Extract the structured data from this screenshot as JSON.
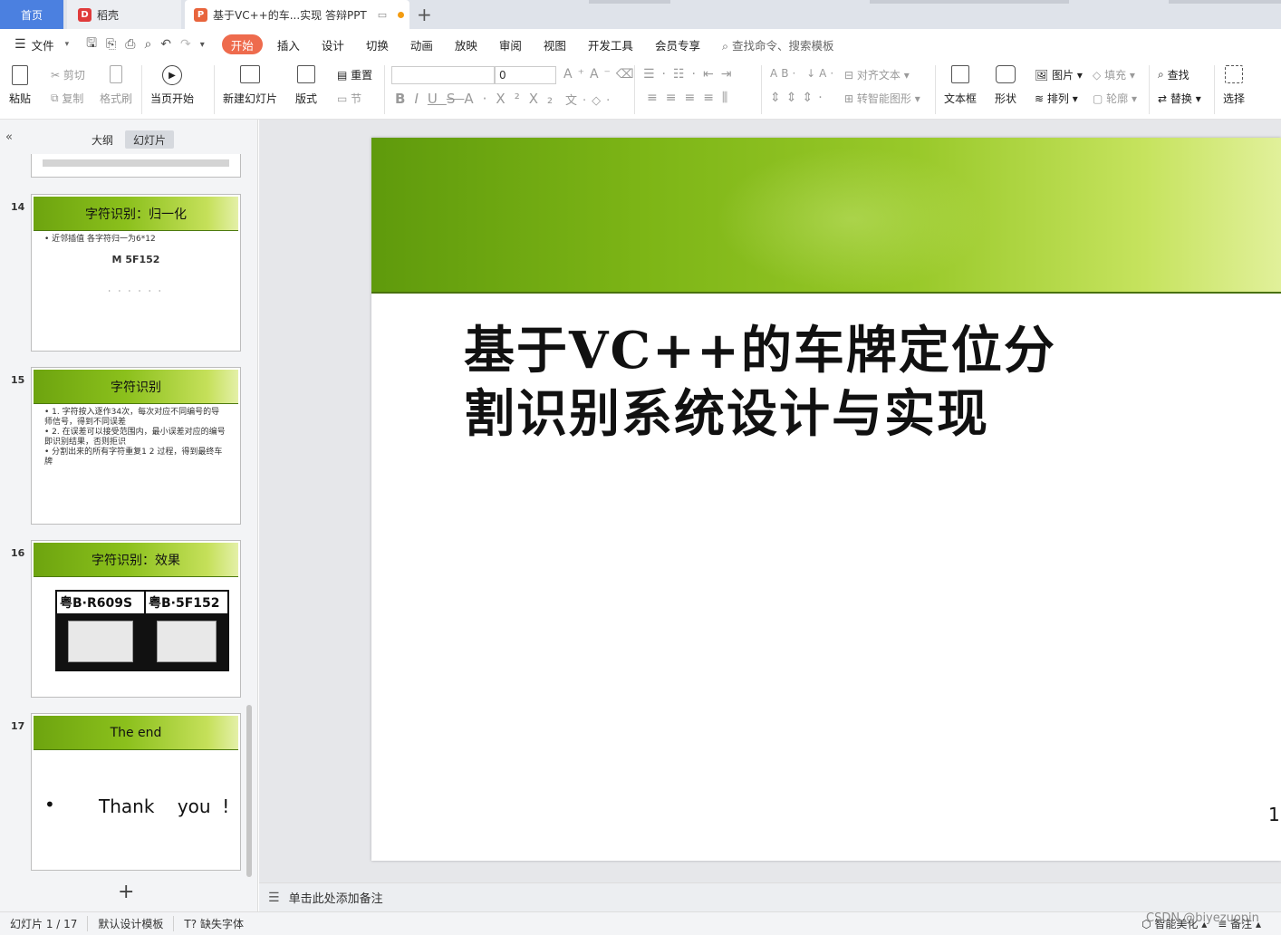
{
  "tabs": {
    "home": "首页",
    "straw": "稻壳",
    "doc": "基于VC++的车...实现 答辩PPT"
  },
  "menu": {
    "file": "文件",
    "items": [
      "开始",
      "插入",
      "设计",
      "切换",
      "动画",
      "放映",
      "审阅",
      "视图",
      "开发工具",
      "会员专享"
    ],
    "search": "查找命令、搜索模板"
  },
  "ribbon": {
    "paste": "粘贴",
    "cut": "剪切",
    "copy": "复制",
    "format_painter": "格式刷",
    "play_from": "当页开始",
    "new_slide": "新建幻灯片",
    "layout": "版式",
    "reset": "重置",
    "section": "节",
    "font_size": "0",
    "align_text": "对齐文本",
    "smart_art": "转智能图形",
    "textbox": "文本框",
    "shape": "形状",
    "picture": "图片",
    "arrange": "排列",
    "fill": "填充",
    "outline": "轮廓",
    "find": "查找",
    "replace": "替换",
    "select": "选择"
  },
  "left_panel": {
    "tab_outline": "大纲",
    "tab_slides": "幻灯片",
    "add": "+"
  },
  "slides": [
    {
      "num": "14",
      "title": "字符识别：归一化",
      "bullets": [
        "近邻插值  各字符归一为6*12"
      ],
      "plate": "M 5F152"
    },
    {
      "num": "15",
      "title": "字符识别",
      "bullets": [
        "1. 字符按入逐作34次，每次对应不同编号的导师信号，得到不同误差",
        "2. 在误差可以接受范围内，最小误差对应的编号即识别结果，否则拒识",
        "分割出来的所有字符重复1 2 过程，得到最终车牌"
      ]
    },
    {
      "num": "16",
      "title": "字符识别：效果",
      "plates": [
        "粤B·R609S",
        "粤B·5F152"
      ]
    },
    {
      "num": "17",
      "title": "The   end",
      "bullet": "Thank    you  !"
    }
  ],
  "main_slide": {
    "title_line1": "基于VC++的车牌定位分",
    "title_line2": "割识别系统设计与实现",
    "page": "1"
  },
  "notes": "单击此处添加备注",
  "status": {
    "slide_count": "幻灯片 1 / 17",
    "template": "默认设计模板",
    "missing_font": "缺失字体",
    "beautify": "智能美化",
    "notes": "备注"
  },
  "watermark": "CSDN @biyezuopin"
}
